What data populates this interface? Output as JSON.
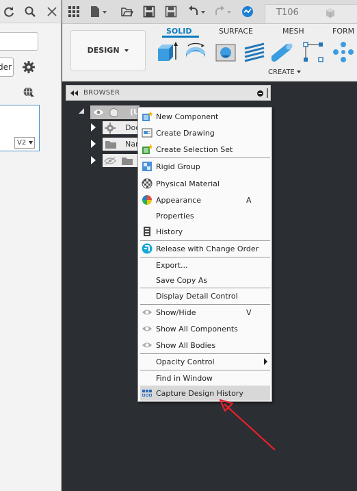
{
  "left_panel": {
    "order_button_label": "der",
    "version": "V2"
  },
  "document_tab": {
    "label": "T106"
  },
  "ribbon": {
    "workspace_label": "DESIGN",
    "tabs": [
      {
        "label": "SOLID",
        "active": true
      },
      {
        "label": "SURFACE"
      },
      {
        "label": "MESH"
      },
      {
        "label": "FORM"
      }
    ],
    "create_menu_label": "CREATE"
  },
  "browser": {
    "label": "BROWSER",
    "root_label": "(U",
    "rows": [
      {
        "label": "Doc",
        "icon": "gear-icon"
      },
      {
        "label": "Nan",
        "icon": "folder-icon"
      },
      {
        "label": "",
        "icon": "folder-icon"
      }
    ]
  },
  "context_menu": {
    "items": [
      {
        "label": "New Component",
        "icon": "new-component-icon"
      },
      {
        "label": "Create Drawing",
        "icon": "create-drawing-icon"
      },
      {
        "label": "Create Selection Set",
        "icon": "selection-set-icon"
      },
      {
        "label": "Rigid Group",
        "icon": "rigid-group-icon"
      },
      {
        "label": "Physical Material",
        "icon": "physical-material-icon"
      },
      {
        "label": "Appearance",
        "icon": "appearance-icon",
        "shortcut": "A"
      },
      {
        "label": "Properties"
      },
      {
        "label": "History",
        "icon": "history-icon"
      },
      {
        "label": "Release with Change Order",
        "icon": "release-icon"
      },
      {
        "label": "Export..."
      },
      {
        "label": "Save Copy As"
      },
      {
        "label": "Display Detail Control"
      },
      {
        "label": "Show/Hide",
        "icon": "eye-icon",
        "shortcut": "V"
      },
      {
        "label": "Show All Components",
        "icon": "eye-icon"
      },
      {
        "label": "Show All Bodies",
        "icon": "eye-icon"
      },
      {
        "label": "Opacity Control",
        "has_submenu": true
      },
      {
        "label": "Find in Window"
      },
      {
        "label": "Capture Design History",
        "icon": "capture-history-icon",
        "highlighted": true
      }
    ]
  },
  "colors": {
    "accent": "#0a7bc2",
    "canvas": "#2b2e33",
    "annotation": "#e8202a"
  }
}
